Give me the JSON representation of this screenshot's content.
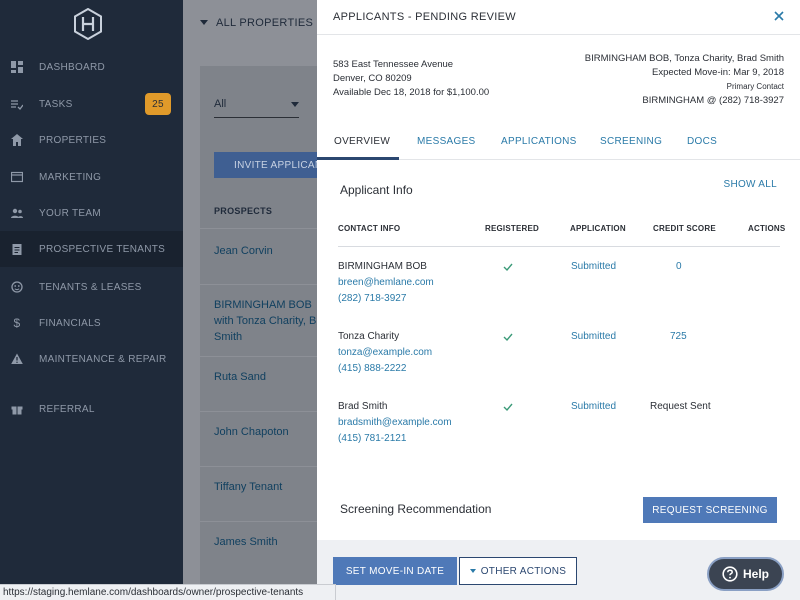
{
  "sidebar": {
    "items": [
      {
        "label": "DASHBOARD",
        "icon": "dashboard-icon"
      },
      {
        "label": "TASKS",
        "icon": "tasks-icon",
        "badge": "25"
      },
      {
        "label": "PROPERTIES",
        "icon": "home-icon"
      },
      {
        "label": "MARKETING",
        "icon": "marketing-icon"
      },
      {
        "label": "YOUR TEAM",
        "icon": "team-icon"
      },
      {
        "label": "PROSPECTIVE TENANTS",
        "icon": "clipboard-icon",
        "active": true
      },
      {
        "label": "TENANTS & LEASES",
        "icon": "tenants-icon"
      },
      {
        "label": "FINANCIALS",
        "icon": "dollar-icon"
      },
      {
        "label": "MAINTENANCE & REPAIR",
        "icon": "warning-icon"
      },
      {
        "label": "REFERRAL",
        "icon": "gift-icon"
      }
    ]
  },
  "topbar": {
    "title": "ALL PROPERTIES"
  },
  "background": {
    "filter_value": "All",
    "invite_label": "INVITE APPLICANT",
    "prospects_header": "PROSPECTS",
    "prospects": [
      "Jean Corvin",
      "BIRMINGHAM BOB",
      "with Tonza Charity, Brad",
      "Smith",
      "Ruta Sand",
      "John Chapoton",
      "Tiffany Tenant",
      "James Smith"
    ]
  },
  "modal": {
    "title": "APPLICANTS - PENDING REVIEW",
    "address": {
      "line1": "583 East Tennessee Avenue",
      "line2": "Denver, CO 80209",
      "line3": "Available Dec 18, 2018 for $1,100.00"
    },
    "tenants": {
      "names": "BIRMINGHAM BOB, Tonza Charity, Brad Smith",
      "move_in": "Expected Move-in: Mar 9, 2018",
      "primary_label": "Primary Contact",
      "primary_value": "BIRMINGHAM @ (282) 718-3927"
    },
    "tabs": [
      "OVERVIEW",
      "MESSAGES",
      "APPLICATIONS",
      "SCREENING",
      "DOCS"
    ],
    "applicant_info": {
      "title": "Applicant Info",
      "show_all": "SHOW ALL",
      "columns": [
        "CONTACT INFO",
        "REGISTERED",
        "APPLICATION",
        "CREDIT SCORE",
        "ACTIONS"
      ],
      "rows": [
        {
          "name": "BIRMINGHAM BOB",
          "email": "breen@hemlane.com",
          "phone": "(282) 718-3927",
          "application": "Submitted",
          "credit": "0"
        },
        {
          "name": "Tonza Charity",
          "email": "tonza@example.com",
          "phone": "(415) 888-2222",
          "application": "Submitted",
          "credit": "725"
        },
        {
          "name": "Brad Smith",
          "email": "bradsmith@example.com",
          "phone": "(415) 781-2121",
          "application": "Submitted",
          "credit": "Request Sent"
        }
      ]
    },
    "screening": {
      "title": "Screening Recommendation",
      "button": "REQUEST SCREENING"
    },
    "footer": {
      "move_in_button": "SET MOVE-IN DATE",
      "other_actions_button": "OTHER ACTIONS",
      "help_label": "Help"
    }
  },
  "statusbar": {
    "url": "https://staging.hemlane.com/dashboards/owner/prospective-tenants"
  },
  "colors": {
    "sidebar": "#1f2a3a",
    "accent": "#4f79b8",
    "link": "#2a7aa8",
    "badge": "#e09a2a"
  }
}
